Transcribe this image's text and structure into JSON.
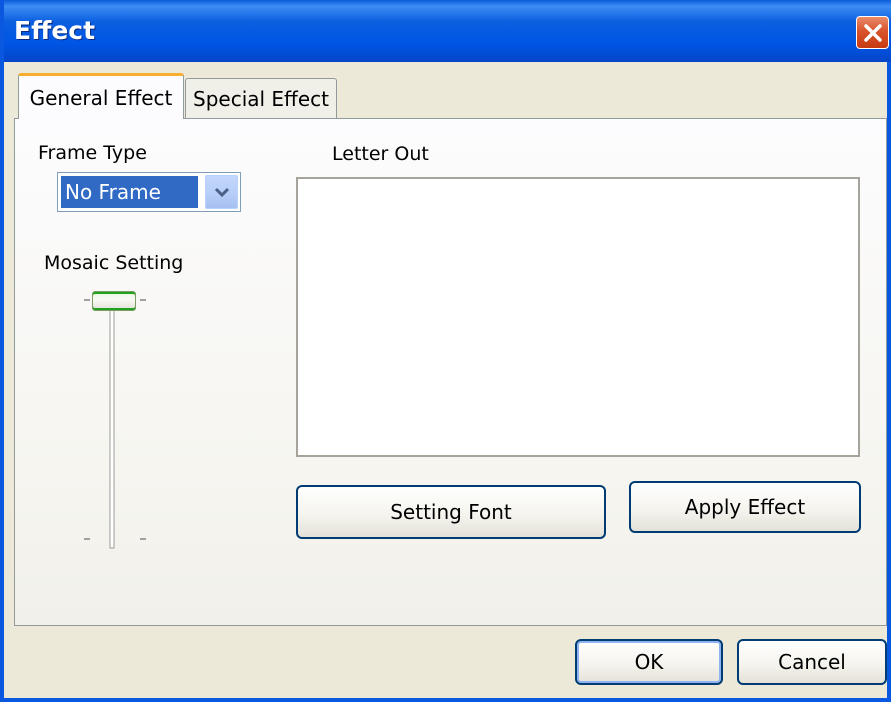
{
  "window": {
    "title": "Effect",
    "close_icon": "close-icon"
  },
  "tabs": [
    {
      "label": "General Effect",
      "active": true
    },
    {
      "label": "Special Effect",
      "active": false
    }
  ],
  "frame_type": {
    "label": "Frame Type",
    "selected": "No Frame",
    "arrow_icon": "chevron-down-icon"
  },
  "mosaic": {
    "label": "Mosaic Setting",
    "level": 0
  },
  "letter_out": {
    "label": "Letter Out",
    "value": ""
  },
  "buttons": {
    "setting_font": "Setting Font",
    "apply_effect": "Apply Effect",
    "ok": "OK",
    "cancel": "Cancel"
  },
  "colors": {
    "titlebar": "#0055e5",
    "selection": "#316ac5",
    "active_tab_accent": "#f7ae2e"
  }
}
